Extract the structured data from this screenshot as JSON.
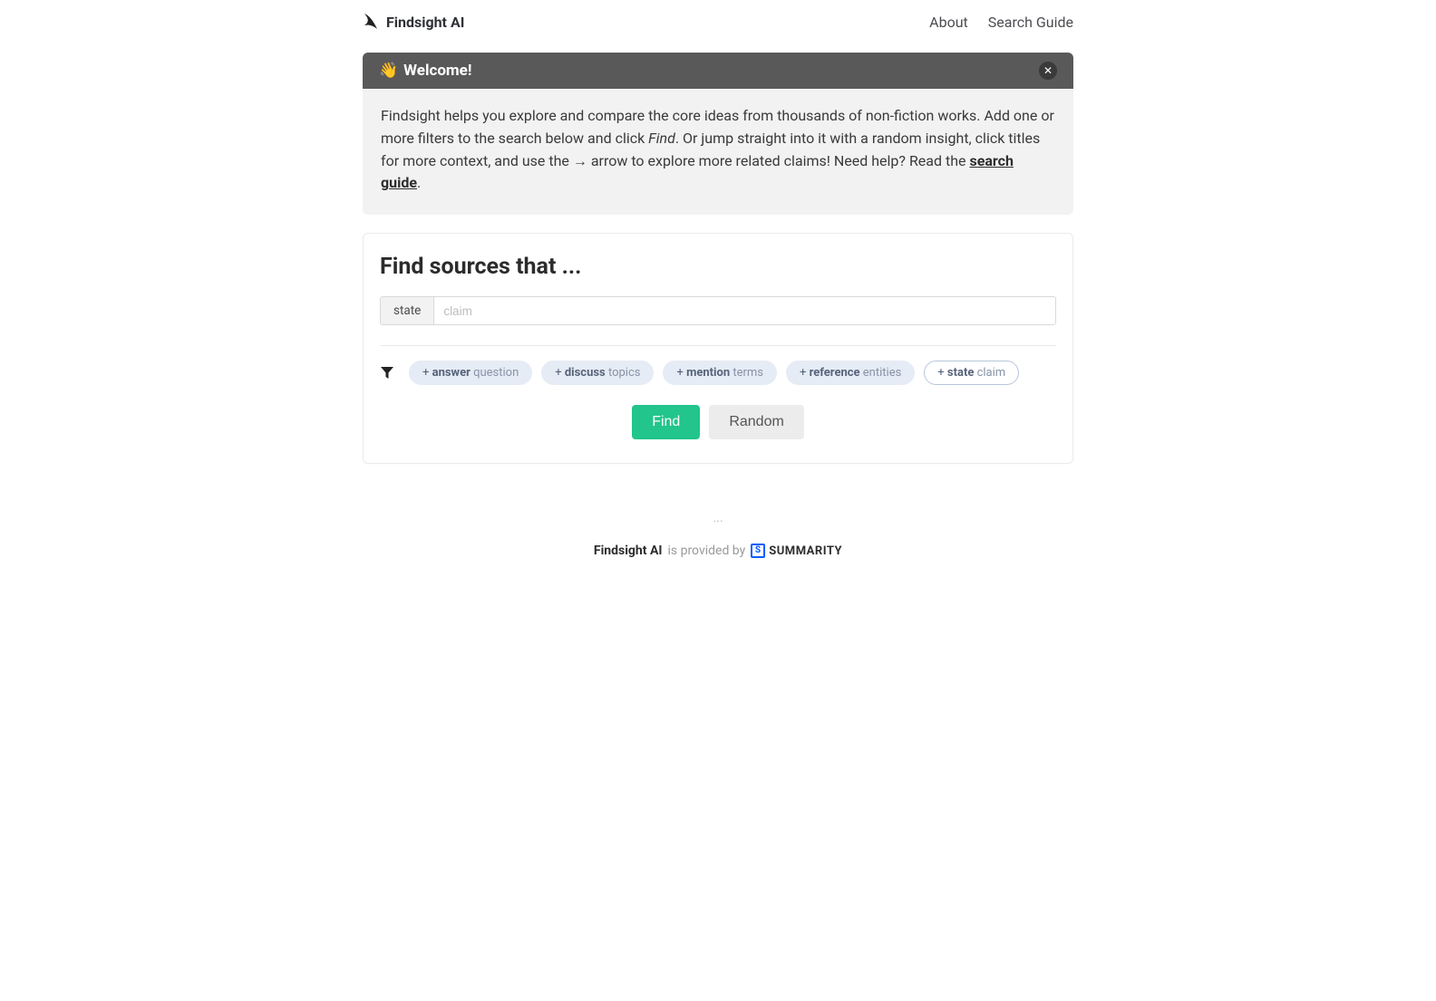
{
  "header": {
    "brand": "Findsight AI",
    "nav": {
      "about": "About",
      "search_guide": "Search Guide"
    }
  },
  "banner": {
    "emoji": "👋",
    "title": "Welcome!",
    "body_part1": "Findsight helps you explore and compare the core ideas from thousands of non-fiction works. Add one or more filters to the search below and click ",
    "find_word": "Find",
    "body_part2": ". Or jump straight into it with a random insight, click titles for more context, and use the ",
    "arrow": "→",
    "body_part3": " arrow to explore more related claims! Need help? Read the ",
    "search_guide_link": "search guide",
    "body_part4": "."
  },
  "search": {
    "title": "Find sources that ...",
    "active_filter": {
      "tag": "state",
      "placeholder": "claim"
    },
    "chips": [
      {
        "plus": "+ ",
        "bold": "answer",
        "light": " question"
      },
      {
        "plus": "+ ",
        "bold": "discuss",
        "light": " topics"
      },
      {
        "plus": "+ ",
        "bold": "mention",
        "light": " terms"
      },
      {
        "plus": "+ ",
        "bold": "reference",
        "light": " entities"
      },
      {
        "plus": "+ ",
        "bold": "state",
        "light": " claim",
        "outline": true
      }
    ],
    "actions": {
      "find": "Find",
      "random": "Random"
    }
  },
  "footer": {
    "dots": "...",
    "brand": "Findsight AI",
    "provided_by": " is provided by ",
    "provider_badge": "S",
    "provider_name": "SUMMARITY"
  }
}
